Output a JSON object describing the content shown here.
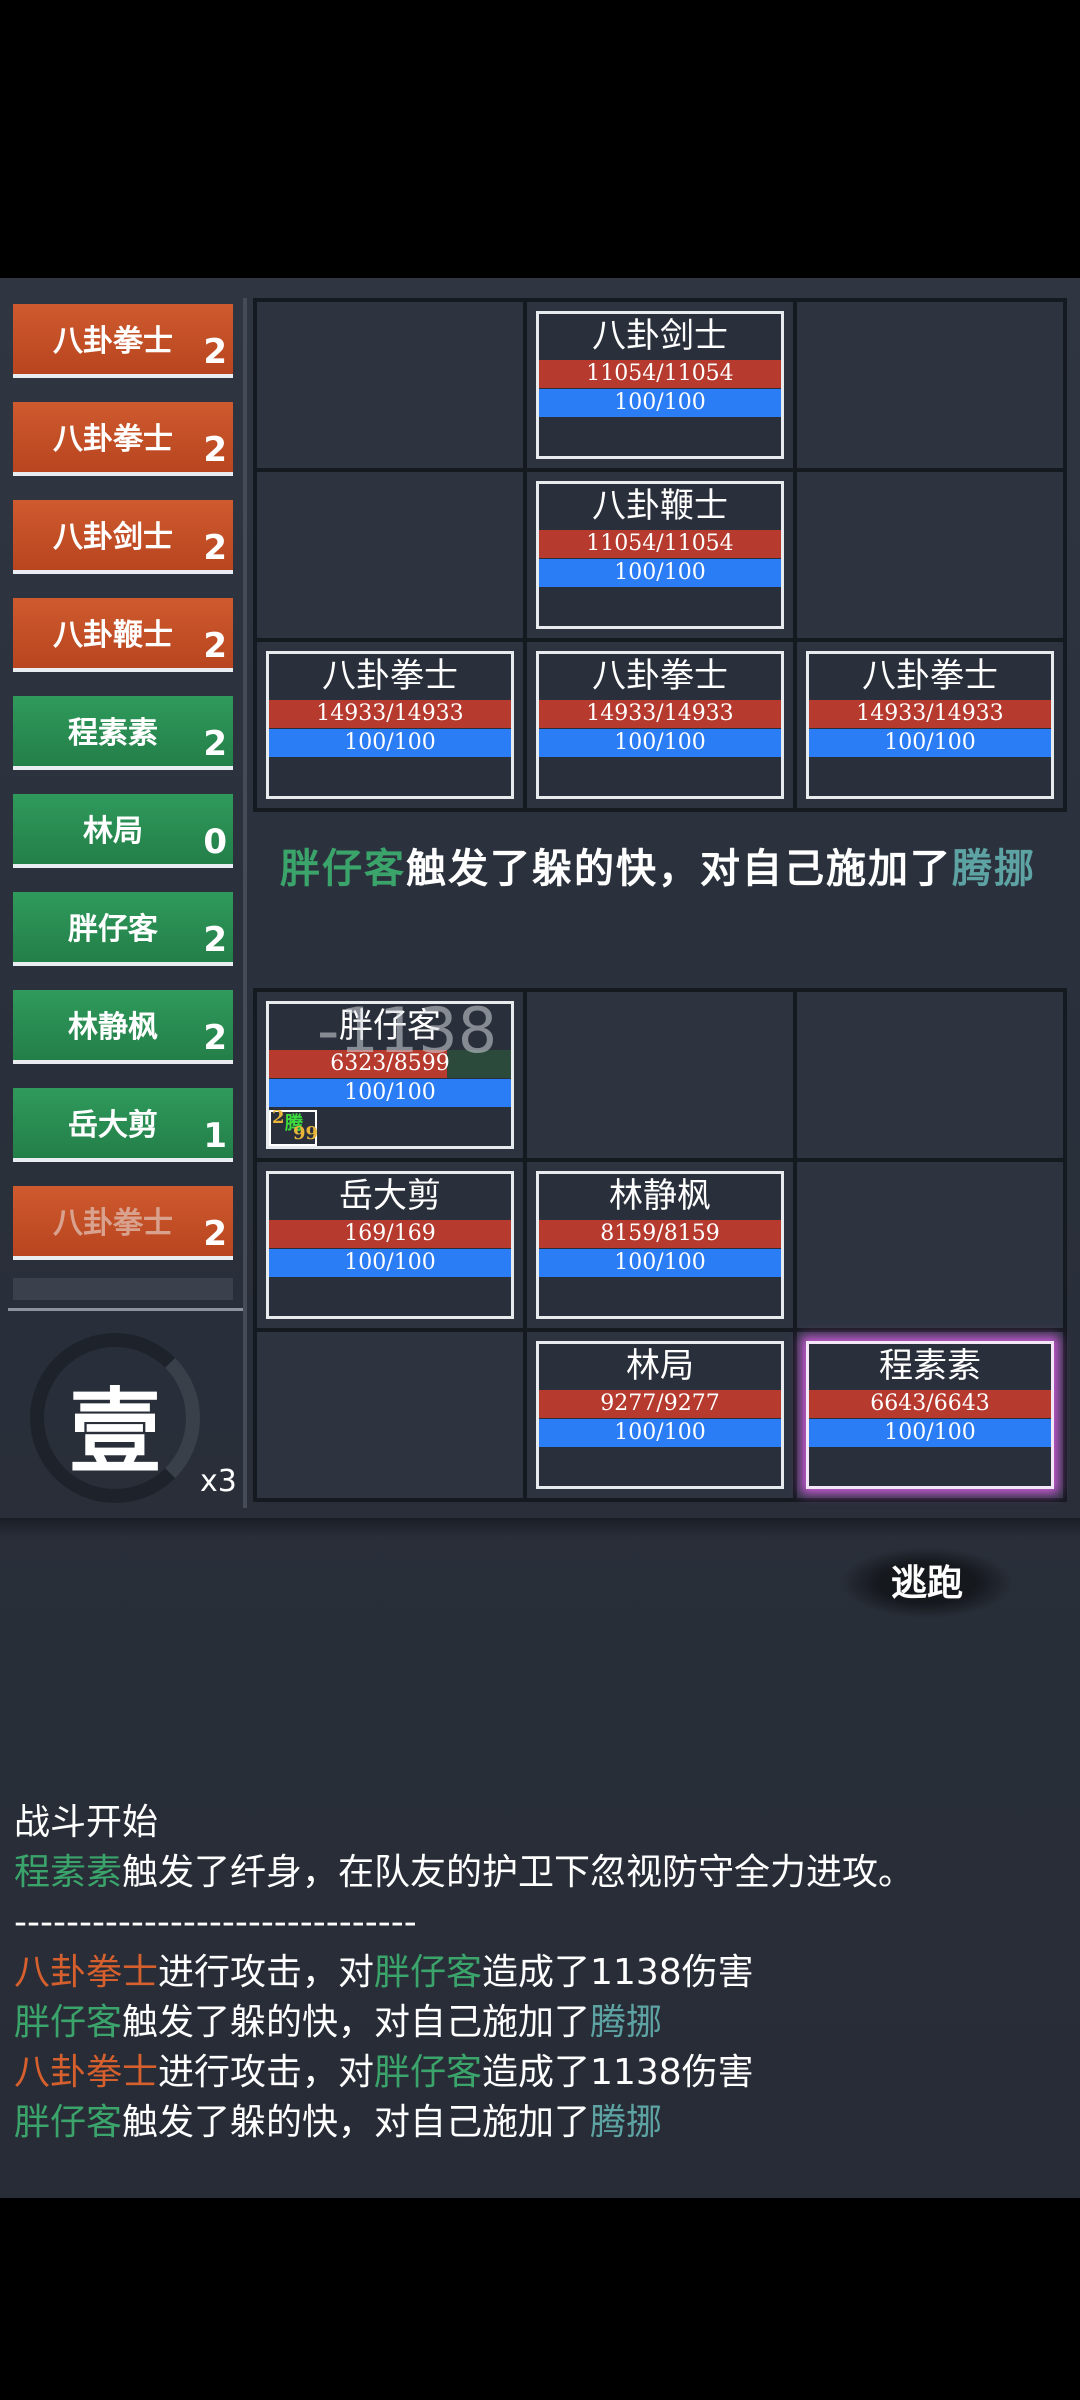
{
  "turn_order": [
    {
      "name": "八卦拳士",
      "count": "2",
      "side": "enemy"
    },
    {
      "name": "八卦拳士",
      "count": "2",
      "side": "enemy"
    },
    {
      "name": "八卦剑士",
      "count": "2",
      "side": "enemy"
    },
    {
      "name": "八卦鞭士",
      "count": "2",
      "side": "enemy"
    },
    {
      "name": "程素素",
      "count": "2",
      "side": "ally"
    },
    {
      "name": "林局",
      "count": "0",
      "side": "ally"
    },
    {
      "name": "胖仔客",
      "count": "2",
      "side": "ally"
    },
    {
      "name": "林静枫",
      "count": "2",
      "side": "ally"
    },
    {
      "name": "岳大剪",
      "count": "1",
      "side": "ally"
    },
    {
      "name": "八卦拳士",
      "count": "2",
      "side": "enemy"
    }
  ],
  "turn": {
    "round_char": "壹",
    "speed": "x3"
  },
  "enemies": {
    "sword": {
      "name": "八卦剑士",
      "hp": "11054/11054",
      "mp": "100/100",
      "hp_fraction": 1.0
    },
    "whip": {
      "name": "八卦鞭士",
      "hp": "11054/11054",
      "mp": "100/100",
      "hp_fraction": 1.0
    },
    "fist_left": {
      "name": "八卦拳士",
      "hp": "14933/14933",
      "mp": "100/100",
      "hp_fraction": 1.0
    },
    "fist_mid": {
      "name": "八卦拳士",
      "hp": "14933/14933",
      "mp": "100/100",
      "hp_fraction": 1.0
    },
    "fist_right": {
      "name": "八卦拳士",
      "hp": "14933/14933",
      "mp": "100/100",
      "hp_fraction": 1.0
    }
  },
  "announcement": {
    "actor": "胖仔客",
    "text": "触发了躲的快，对自己施加了",
    "effect": "腾挪"
  },
  "allies": {
    "pangzaike": {
      "name": "胖仔客",
      "hp": "6323/8599",
      "mp": "100/100",
      "hp_fraction": 0.735,
      "buff": {
        "stack": "2",
        "label": "腾",
        "turns": "99"
      },
      "damage_float": "-1138"
    },
    "yuedajian": {
      "name": "岳大剪",
      "hp": "169/169",
      "mp": "100/100",
      "hp_fraction": 1.0
    },
    "linjingfeng": {
      "name": "林静枫",
      "hp": "8159/8159",
      "mp": "100/100",
      "hp_fraction": 1.0
    },
    "linju": {
      "name": "林局",
      "hp": "9277/9277",
      "mp": "100/100",
      "hp_fraction": 1.0
    },
    "chengsusu": {
      "name": "程素素",
      "hp": "6643/6643",
      "mp": "100/100",
      "hp_fraction": 1.0
    }
  },
  "flee_label": "逃跑",
  "log": {
    "start": "战斗开始",
    "line1": {
      "actor": "程素素",
      "text": "触发了纤身，在队友的护卫下忽视防守全力进攻。"
    },
    "divider": "-------------------------------",
    "line2": {
      "actor": "八卦拳士",
      "mid": "进行攻击，对",
      "target": "胖仔客",
      "text": "造成了1138伤害"
    },
    "line3": {
      "actor": "胖仔客",
      "text": "触发了躲的快，对自己施加了",
      "effect": "腾挪"
    },
    "line4": {
      "actor": "八卦拳士",
      "mid": "进行攻击，对",
      "target": "胖仔客",
      "text": "造成了1138伤害"
    },
    "line5": {
      "actor": "胖仔客",
      "text": "触发了躲的快，对自己施加了",
      "effect": "腾挪"
    }
  },
  "colors": {
    "enemy": "#c8502a",
    "ally": "#2a8d52",
    "hp": "#b63a2e",
    "mp": "#2a7df5",
    "selected_glow": "#c65ad3"
  }
}
